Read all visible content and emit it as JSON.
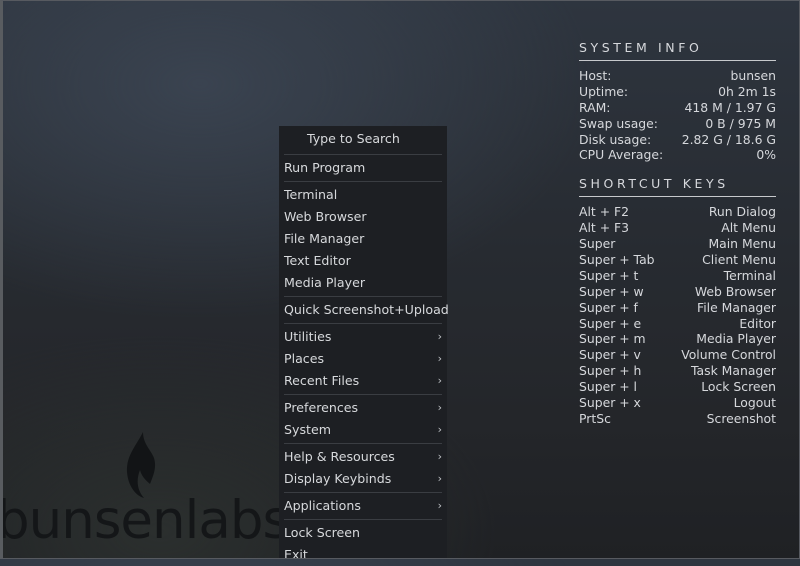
{
  "wallpaper": {
    "logo_text": "bunsenlabs"
  },
  "system_info": {
    "heading": "SYSTEM INFO",
    "rows": [
      {
        "label": "Host:",
        "value": "bunsen"
      },
      {
        "label": "Uptime:",
        "value": "0h 2m 1s"
      },
      {
        "label": "RAM:",
        "value": "418 M / 1.97 G"
      },
      {
        "label": "Swap usage:",
        "value": "0 B / 975 M"
      },
      {
        "label": "Disk usage:",
        "value": "2.82 G / 18.6 G"
      },
      {
        "label": "CPU Average:",
        "value": "0%"
      }
    ]
  },
  "shortcut_keys": {
    "heading": "SHORTCUT KEYS",
    "rows": [
      {
        "key": "Alt + F2",
        "action": "Run Dialog"
      },
      {
        "key": "Alt + F3",
        "action": "Alt Menu"
      },
      {
        "key": "Super",
        "action": "Main Menu"
      },
      {
        "key": "Super + Tab",
        "action": "Client Menu"
      },
      {
        "key": "Super + t",
        "action": "Terminal"
      },
      {
        "key": "Super + w",
        "action": "Web Browser"
      },
      {
        "key": "Super + f",
        "action": "File Manager"
      },
      {
        "key": "Super + e",
        "action": "Editor"
      },
      {
        "key": "Super + m",
        "action": "Media Player"
      },
      {
        "key": "Super + v",
        "action": "Volume Control"
      },
      {
        "key": "Super + h",
        "action": "Task Manager"
      },
      {
        "key": "Super + l",
        "action": "Lock Screen"
      },
      {
        "key": "Super + x",
        "action": "Logout"
      },
      {
        "key": "PrtSc",
        "action": "Screenshot"
      }
    ]
  },
  "menu": {
    "search_label": "Type to Search",
    "submenu_arrow": "›",
    "items": {
      "run_program": "Run Program",
      "terminal": "Terminal",
      "web_browser": "Web Browser",
      "file_manager": "File Manager",
      "text_editor": "Text Editor",
      "media_player": "Media Player",
      "quick_screenshot": "Quick Screenshot+Upload",
      "utilities": "Utilities",
      "places": "Places",
      "recent_files": "Recent Files",
      "preferences": "Preferences",
      "system": "System",
      "help_resources": "Help & Resources",
      "display_keybinds": "Display Keybinds",
      "applications": "Applications",
      "lock_screen": "Lock Screen",
      "exit": "Exit"
    }
  }
}
